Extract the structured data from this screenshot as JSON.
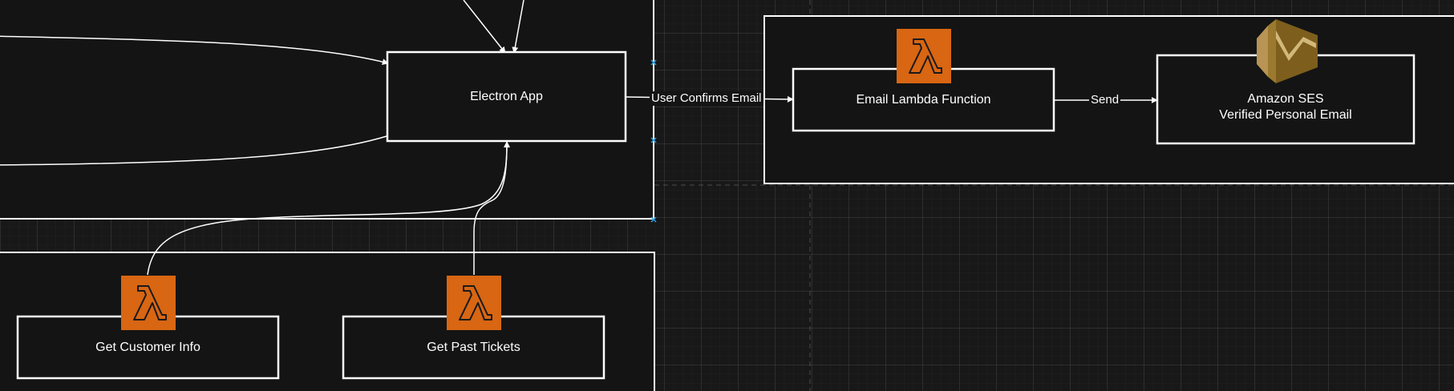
{
  "nodes": {
    "electron_app": {
      "label": "Electron App"
    },
    "email_lambda": {
      "label": "Email Lambda Function"
    },
    "amazon_ses": {
      "label": "Amazon SES\nVerified Personal Email"
    },
    "get_customer_info": {
      "label": "Get Customer Info"
    },
    "get_past_tickets": {
      "label": "Get Past Tickets"
    }
  },
  "edges": {
    "electron_to_lambda": {
      "label": "User Confirms Email"
    },
    "lambda_to_ses": {
      "label": "Send"
    }
  },
  "icons": {
    "lambda": "aws-lambda-icon",
    "ses": "amazon-ses-icon"
  },
  "colors": {
    "background": "#181818",
    "container_fill": "#141414",
    "stroke": "#ffffff",
    "lambda_orange": "#d86613",
    "ses_gold": "#9b7a2f",
    "selection_handle": "#29a3e6"
  }
}
